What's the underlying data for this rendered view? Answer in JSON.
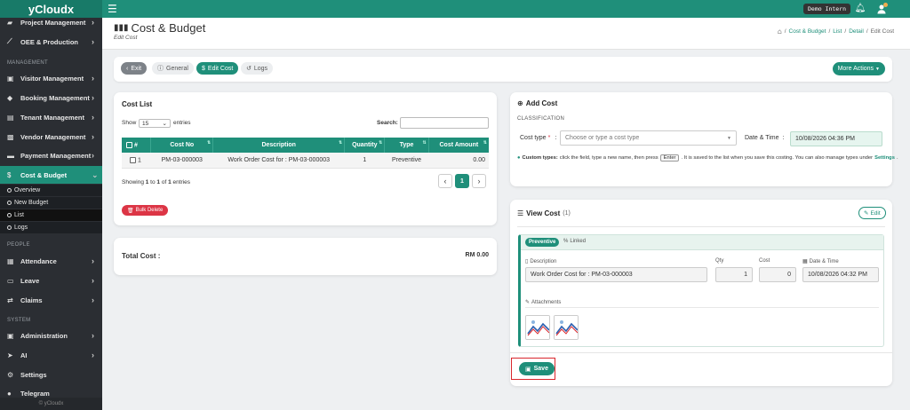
{
  "app": {
    "brand": "yCloudx",
    "user_badge": "Demo Intern",
    "footer": "© yCloudx"
  },
  "sidebar": {
    "items_top": [
      {
        "label": "Project Management",
        "icon": "project-icon"
      },
      {
        "label": "OEE & Production",
        "icon": "chart-line-icon"
      }
    ],
    "section_management": "MANAGEMENT",
    "items_management": [
      {
        "label": "Visitor Management",
        "icon": "id-card-icon"
      },
      {
        "label": "Booking Management",
        "icon": "tag-icon"
      },
      {
        "label": "Tenant Management",
        "icon": "building-icon"
      },
      {
        "label": "Vendor Management",
        "icon": "vendor-card-icon"
      },
      {
        "label": "Payment Management",
        "icon": "truck-icon"
      },
      {
        "label": "Cost & Budget",
        "icon": "dollar-icon"
      }
    ],
    "sub_items": [
      "Overview",
      "New Budget",
      "List",
      "Logs"
    ],
    "section_people": "PEOPLE",
    "items_people": [
      {
        "label": "Attendance",
        "icon": "calendar-icon"
      },
      {
        "label": "Leave",
        "icon": "suitcase-icon"
      },
      {
        "label": "Claims",
        "icon": "exchange-icon"
      }
    ],
    "section_system": "SYSTEM",
    "items_system": [
      {
        "label": "Administration",
        "icon": "user-admin-icon"
      },
      {
        "label": "AI",
        "icon": "paper-plane-icon"
      },
      {
        "label": "Settings",
        "icon": "gear-icon"
      },
      {
        "label": "Telegram",
        "icon": "telegram-icon"
      }
    ]
  },
  "header": {
    "title": "Cost & Budget",
    "subtitle": "Edit Cost",
    "breadcrumb": [
      "Cost & Budget",
      "List",
      "Detail",
      "Edit Cost"
    ]
  },
  "tabs": {
    "exit": "Exit",
    "general": "General",
    "edit_cost": "Edit Cost",
    "logs": "Logs",
    "more": "More Actions"
  },
  "cost_list": {
    "title": "Cost List",
    "show_label": "Show",
    "page_size": "15",
    "entries_label": "entries",
    "search_label": "Search:",
    "columns": [
      "#",
      "Cost No",
      "Description",
      "Quantity",
      "Type",
      "Cost Amount"
    ],
    "rows": [
      {
        "idx": "1",
        "cost_no": "PM-03-000003",
        "description": "Work Order Cost for : PM-03-000003",
        "quantity": "1",
        "type": "Preventive",
        "amount": "0.00"
      }
    ],
    "showing_pre": "Showing ",
    "showing_from": "1",
    "showing_mid1": " to ",
    "showing_to": "1",
    "showing_mid2": " of ",
    "showing_total": "1",
    "showing_post": " entries",
    "page": "1",
    "bulk_delete": "Bulk Delete"
  },
  "total": {
    "label": "Total Cost :",
    "value": "RM 0.00"
  },
  "add_cost": {
    "title": "Add Cost",
    "section": "CLASSIFICATION",
    "cost_type_label": "Cost type",
    "required_mark": "*",
    "colon": ":",
    "cost_type_placeholder": "Choose or type a cost type",
    "datetime_label": "Date & Time",
    "datetime_value": "10/08/2026 04:36 PM",
    "hint_bold": "Custom types:",
    "hint_text1": "click the field, type a new name, then press",
    "hint_key": "Enter",
    "hint_text2": ". It is saved to the list when you save this costing. You can also manage types under",
    "hint_link": "Settings",
    "hint_end": "."
  },
  "view_cost": {
    "title": "View Cost",
    "count": "(1)",
    "edit": "Edit",
    "tab_active": "Preventive",
    "tab_linked": "Linked",
    "description_label": "Description",
    "description_value": "Work Order Cost for : PM-03-000003",
    "qty_label": "Qty",
    "qty_value": "1",
    "cost_label": "Cost",
    "cost_value": "0",
    "datetime_label": "Date & Time",
    "datetime_value": "10/08/2026 04:32 PM",
    "attachments_label": "Attachments",
    "save": "Save"
  },
  "colors": {
    "brand_teal": "#1f8f7a",
    "sidebar_bg": "#2b2e33",
    "danger": "#dc3545",
    "highlight": "#d9262c"
  }
}
